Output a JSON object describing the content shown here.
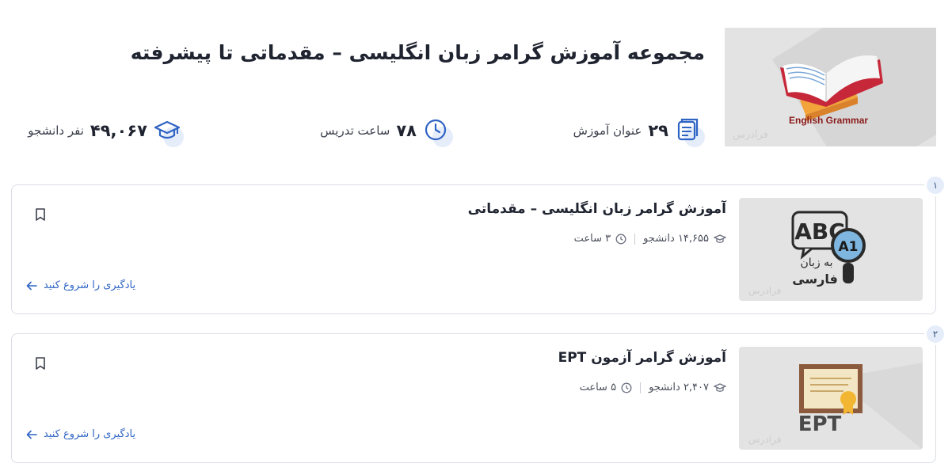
{
  "header": {
    "title": "مجموعه آموزش گرامر زبان انگلیسی – مقدماتی تا پیشرفته",
    "thumbnail_caption": "English Grammar",
    "watermark": "فرادرس"
  },
  "stats": {
    "courses": {
      "value": "۲۹",
      "label": "عنوان آموزش",
      "icon": "book-stack-icon"
    },
    "hours": {
      "value": "۷۸",
      "label": "ساعت تدریس",
      "icon": "clock-icon"
    },
    "students": {
      "value": "۴۹,۰۶۷",
      "label": "نفر دانشجو",
      "icon": "graduation-cap-icon"
    }
  },
  "courses": [
    {
      "index": "۱",
      "title": "آموزش گرامر زبان انگلیسی – مقدماتی",
      "students": "۱۴,۶۵۵ دانشجو",
      "duration": "۳ ساعت",
      "action": "یادگیری را شروع کنید",
      "thumbnail": {
        "text_top": "ABC",
        "badge": "A1",
        "line1": "به زبان",
        "line2": "فارسی"
      }
    },
    {
      "index": "۲",
      "title": "آموزش گرامر آزمون EPT",
      "students": "۲,۴۰۷ دانشجو",
      "duration": "۵ ساعت",
      "action": "یادگیری را شروع کنید",
      "thumbnail": {
        "text_top": "EPT"
      }
    }
  ],
  "colors": {
    "accent": "#2f64c4",
    "icon_bubble": "#e6edfa",
    "border": "#d9dde3",
    "thumb_bg": "#e3e3e3"
  }
}
